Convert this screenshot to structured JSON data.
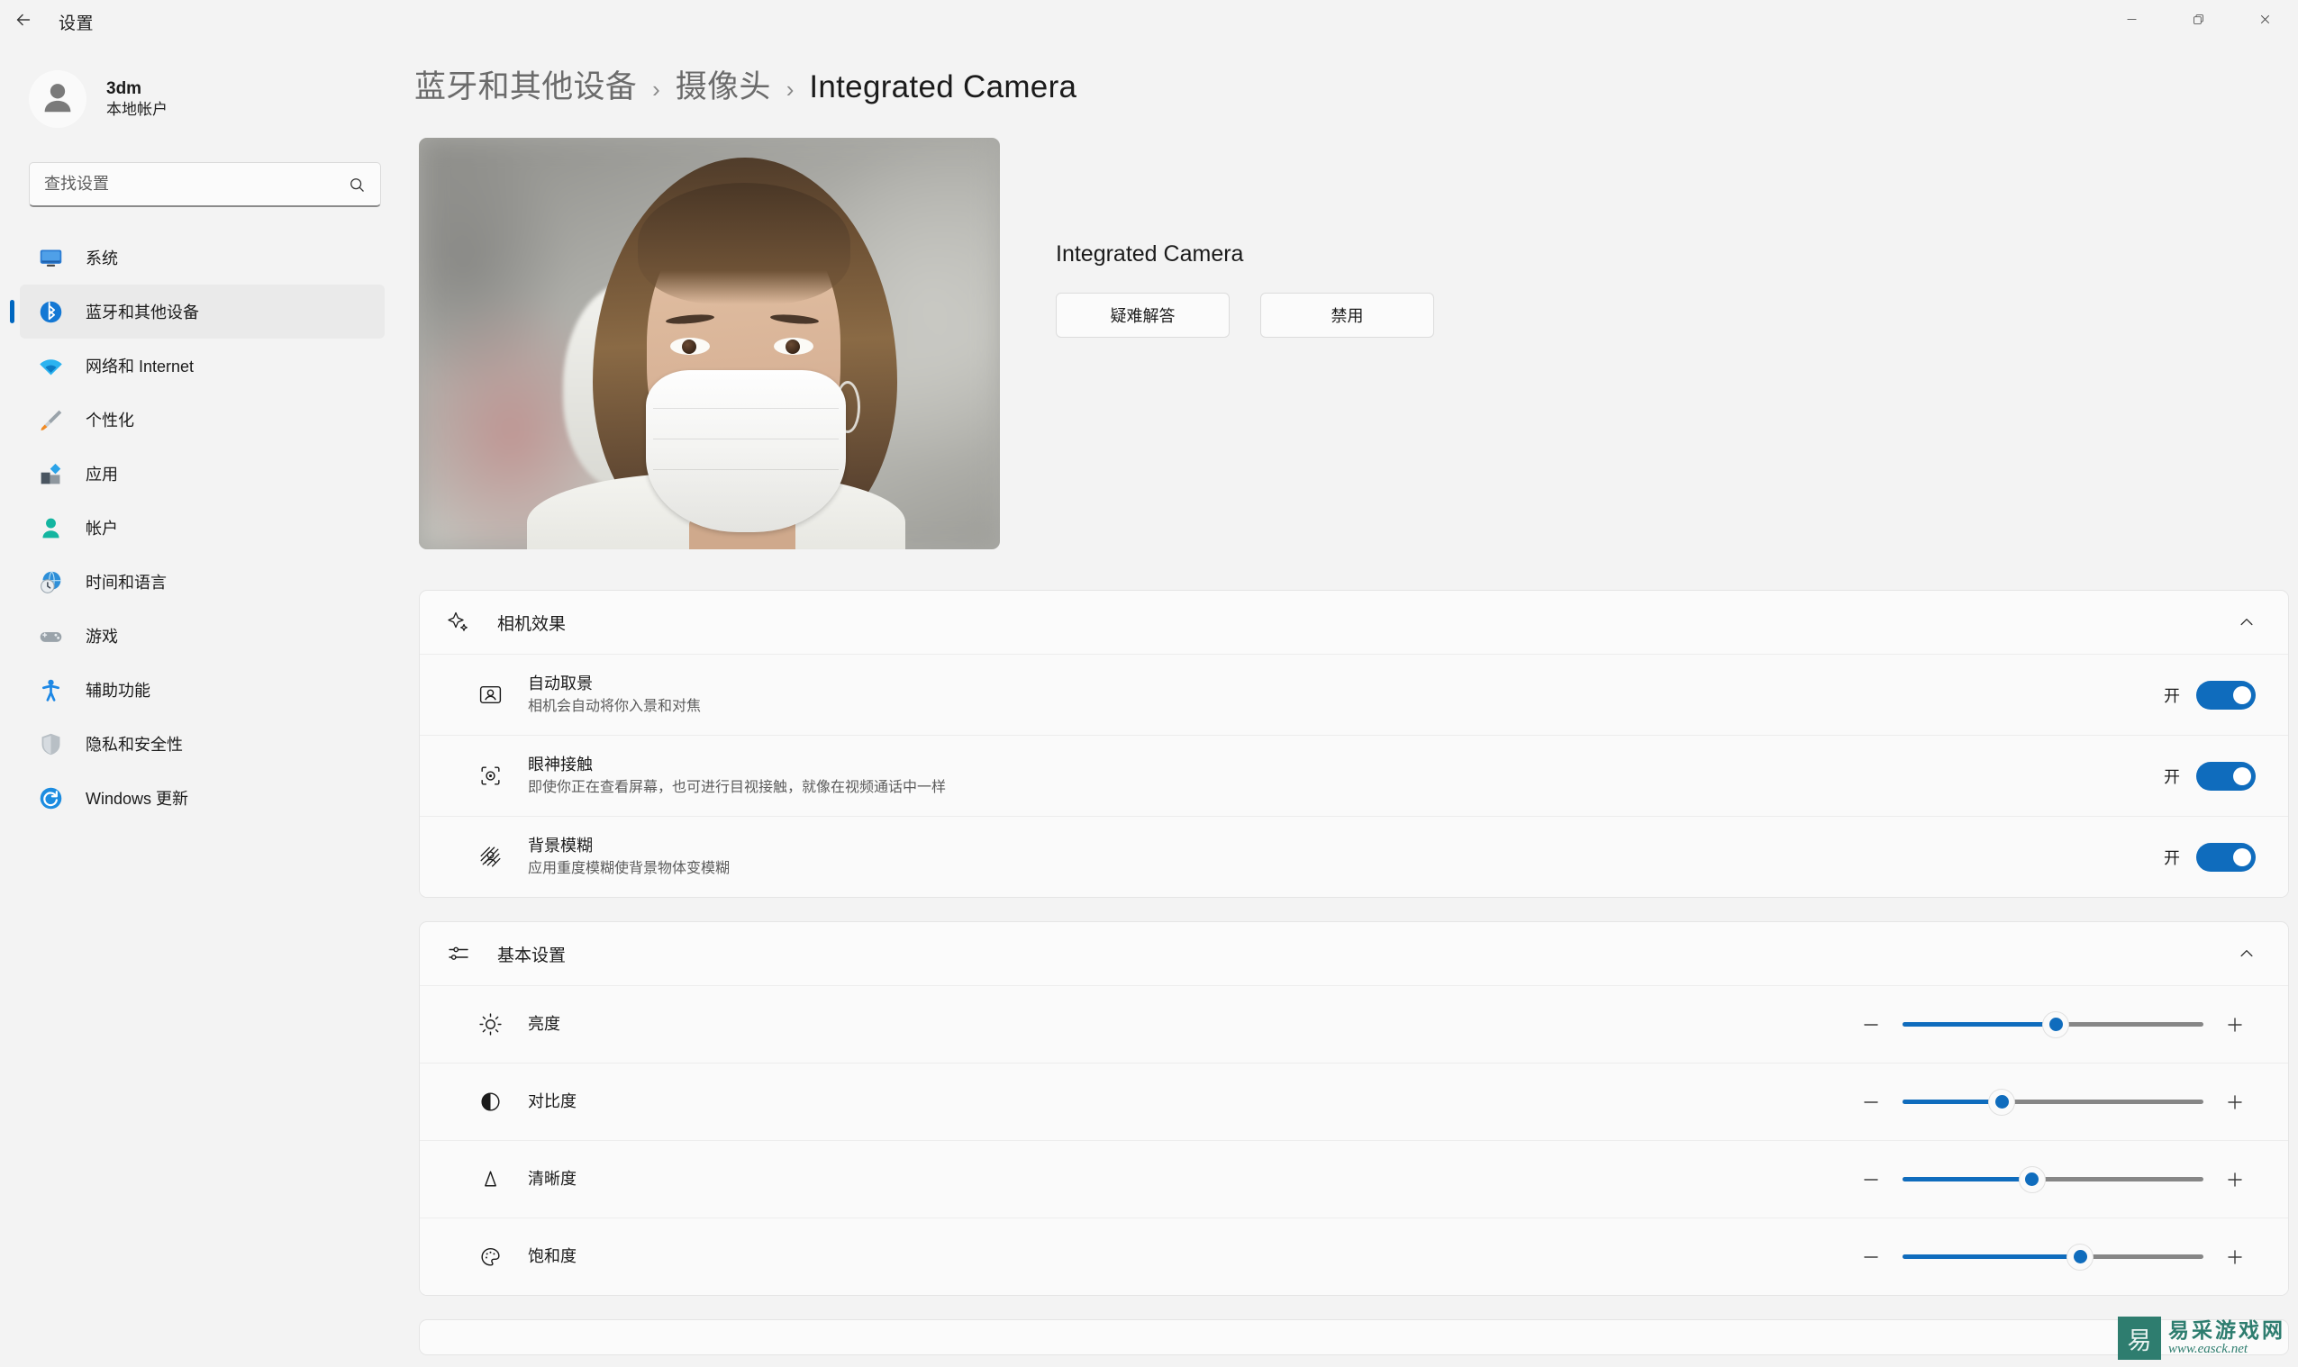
{
  "titlebar": {
    "app_title": "设置",
    "back_icon": "arrow-left-icon",
    "minimize_label": "最小化",
    "restore_label": "还原",
    "close_label": "关闭"
  },
  "sidebar": {
    "account": {
      "name": "3dm",
      "type": "本地帐户",
      "avatar_icon": "user-avatar-icon"
    },
    "search": {
      "placeholder": "查找设置",
      "value": "",
      "icon": "search-icon"
    },
    "items": [
      {
        "label": "系统",
        "icon": "system-monitor-icon",
        "active": false
      },
      {
        "label": "蓝牙和其他设备",
        "icon": "bluetooth-icon",
        "active": true
      },
      {
        "label": "网络和 Internet",
        "icon": "wifi-icon",
        "active": false
      },
      {
        "label": "个性化",
        "icon": "paintbrush-icon",
        "active": false
      },
      {
        "label": "应用",
        "icon": "apps-icon",
        "active": false
      },
      {
        "label": "帐户",
        "icon": "account-person-icon",
        "active": false
      },
      {
        "label": "时间和语言",
        "icon": "clock-globe-icon",
        "active": false
      },
      {
        "label": "游戏",
        "icon": "gamepad-icon",
        "active": false
      },
      {
        "label": "辅助功能",
        "icon": "accessibility-icon",
        "active": false
      },
      {
        "label": "隐私和安全性",
        "icon": "shield-icon",
        "active": false
      },
      {
        "label": "Windows 更新",
        "icon": "update-refresh-icon",
        "active": false
      }
    ]
  },
  "breadcrumb": {
    "crumb1": "蓝牙和其他设备",
    "crumb2": "摄像头",
    "current": "Integrated Camera",
    "separator": "›"
  },
  "camera": {
    "preview_alt": "摄像头预览",
    "name": "Integrated Camera",
    "troubleshoot_button": "疑难解答",
    "disable_button": "禁用"
  },
  "effects_section": {
    "title": "相机效果",
    "icon": "sparkle-icon",
    "collapse_icon": "chevron-up-icon",
    "rows": [
      {
        "title": "自动取景",
        "desc": "相机会自动将你入景和对焦",
        "icon": "auto-framing-icon",
        "toggle_label": "开",
        "toggle_on": true
      },
      {
        "title": "眼神接触",
        "desc": "即使你正在查看屏幕，也可进行目视接触，就像在视频通话中一样",
        "icon": "eye-contact-icon",
        "toggle_label": "开",
        "toggle_on": true
      },
      {
        "title": "背景模糊",
        "desc": "应用重度模糊使背景物体变模糊",
        "icon": "background-blur-icon",
        "toggle_label": "开",
        "toggle_on": true
      }
    ]
  },
  "basic_section": {
    "title": "基本设置",
    "icon": "sliders-icon",
    "collapse_icon": "chevron-up-icon",
    "decrease_icon": "minus-icon",
    "increase_icon": "plus-icon",
    "sliders": [
      {
        "title": "亮度",
        "icon": "brightness-sun-icon",
        "percent": 51
      },
      {
        "title": "对比度",
        "icon": "contrast-circle-icon",
        "percent": 33
      },
      {
        "title": "清晰度",
        "icon": "sharpness-triangle-icon",
        "percent": 43
      },
      {
        "title": "饱和度",
        "icon": "saturation-palette-icon",
        "percent": 59
      }
    ]
  },
  "watermark": {
    "logo_glyph": "易",
    "site_name": "易采游戏网",
    "url": "www.easck.net"
  },
  "colors": {
    "accent": "#0F6CBD",
    "selection_bar": "#0067C0",
    "page_bg": "#F3F3F3",
    "card_bg": "#FBFBFB",
    "watermark": "#2E7D6F"
  }
}
